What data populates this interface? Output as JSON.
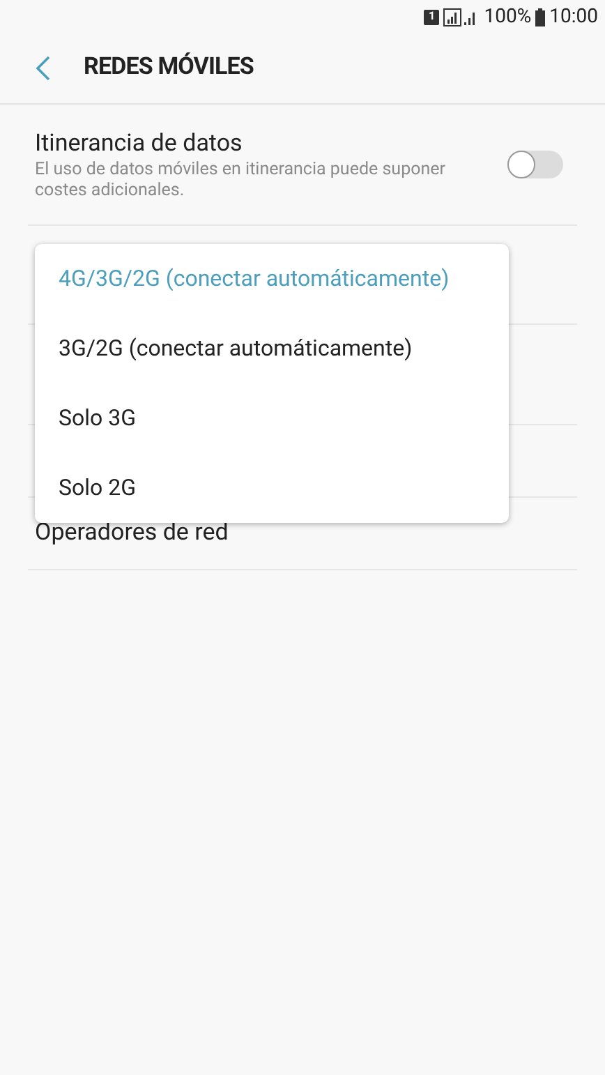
{
  "status_bar": {
    "sim": "1",
    "battery": "100%",
    "time": "10:00"
  },
  "header": {
    "title": "REDES MÓVILES"
  },
  "roaming": {
    "title": "Itinerancia de datos",
    "description": "El uso de datos móviles en itinerancia puede suponer costes adicionales.",
    "on": false
  },
  "network_operators": {
    "title": "Operadores de red"
  },
  "menu": [
    {
      "label": "4G/3G/2G (conectar automáticamente)",
      "selected": true
    },
    {
      "label": "3G/2G (conectar automáticamente)",
      "selected": false
    },
    {
      "label": "Solo 3G",
      "selected": false
    },
    {
      "label": "Solo 2G",
      "selected": false
    }
  ]
}
